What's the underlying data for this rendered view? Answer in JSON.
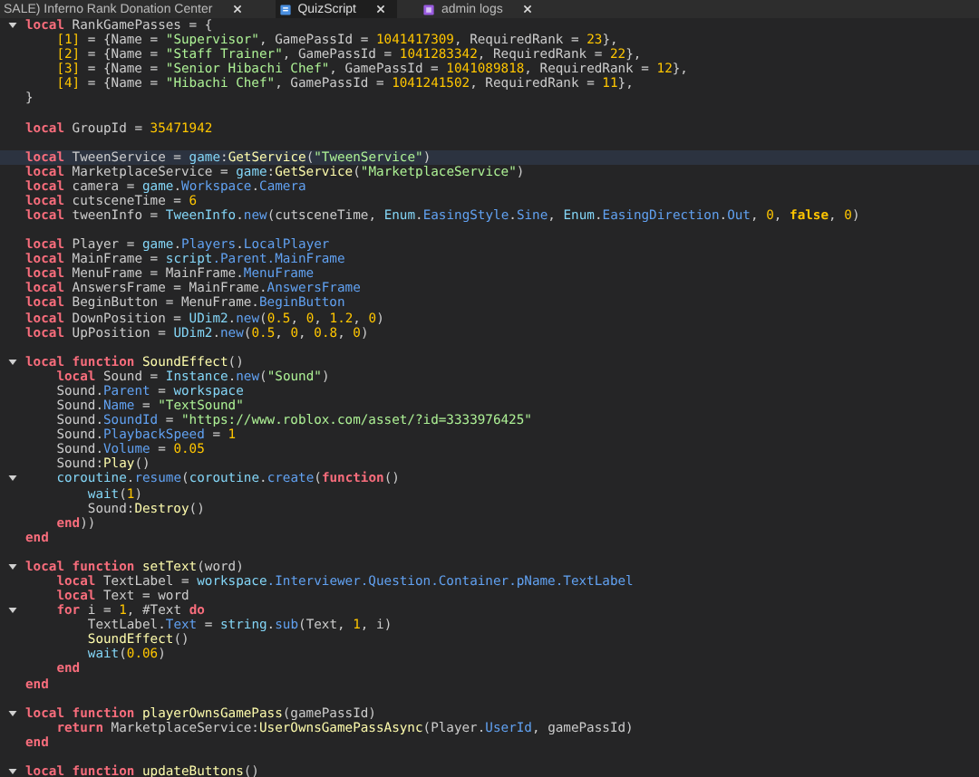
{
  "tabs": [
    {
      "label": "SALE) Inferno Rank Donation Center",
      "selected": false,
      "kind": "none"
    },
    {
      "label": "QuizScript",
      "selected": true,
      "kind": "script"
    },
    {
      "label": "admin logs",
      "selected": false,
      "kind": "module"
    }
  ],
  "lines": [
    {
      "fold": true,
      "current": false,
      "tokens": [
        {
          "kind": "kw",
          "text": "local"
        },
        {
          "kind": "p",
          "text": " RankGamePasses = {"
        }
      ]
    },
    {
      "fold": false,
      "current": false,
      "tokens": [
        {
          "kind": "num",
          "text": "    [1]"
        },
        {
          "kind": "p",
          "text": " = {Name = "
        },
        {
          "kind": "str",
          "text": "\"Supervisor\""
        },
        {
          "kind": "p",
          "text": ", GamePassId = "
        },
        {
          "kind": "num",
          "text": "1041417309"
        },
        {
          "kind": "p",
          "text": ", RequiredRank = "
        },
        {
          "kind": "num",
          "text": "23"
        },
        {
          "kind": "p",
          "text": "},"
        }
      ]
    },
    {
      "fold": false,
      "current": false,
      "tokens": [
        {
          "kind": "num",
          "text": "    [2]"
        },
        {
          "kind": "p",
          "text": " = {Name = "
        },
        {
          "kind": "str",
          "text": "\"Staff Trainer\""
        },
        {
          "kind": "p",
          "text": ", GamePassId = "
        },
        {
          "kind": "num",
          "text": "1041283342"
        },
        {
          "kind": "p",
          "text": ", RequiredRank = "
        },
        {
          "kind": "num",
          "text": "22"
        },
        {
          "kind": "p",
          "text": "},"
        }
      ]
    },
    {
      "fold": false,
      "current": false,
      "tokens": [
        {
          "kind": "num",
          "text": "    [3]"
        },
        {
          "kind": "p",
          "text": " = {Name = "
        },
        {
          "kind": "str",
          "text": "\"Senior Hibachi Chef\""
        },
        {
          "kind": "p",
          "text": ", GamePassId = "
        },
        {
          "kind": "num",
          "text": "1041089818"
        },
        {
          "kind": "p",
          "text": ", RequiredRank = "
        },
        {
          "kind": "num",
          "text": "12"
        },
        {
          "kind": "p",
          "text": "},"
        }
      ]
    },
    {
      "fold": false,
      "current": false,
      "tokens": [
        {
          "kind": "num",
          "text": "    [4]"
        },
        {
          "kind": "p",
          "text": " = {Name = "
        },
        {
          "kind": "str",
          "text": "\"Hibachi Chef\""
        },
        {
          "kind": "p",
          "text": ", GamePassId = "
        },
        {
          "kind": "num",
          "text": "1041241502"
        },
        {
          "kind": "p",
          "text": ", RequiredRank = "
        },
        {
          "kind": "num",
          "text": "11"
        },
        {
          "kind": "p",
          "text": "},"
        }
      ]
    },
    {
      "fold": false,
      "current": false,
      "tokens": [
        {
          "kind": "p",
          "text": "}"
        }
      ]
    },
    {
      "fold": false,
      "current": false
    },
    {
      "fold": false,
      "current": false,
      "tokens": [
        {
          "kind": "kw",
          "text": "local"
        },
        {
          "kind": "p",
          "text": " GroupId = "
        },
        {
          "kind": "num",
          "text": "35471942"
        }
      ]
    },
    {
      "fold": false,
      "current": false
    },
    {
      "fold": false,
      "current": true,
      "tokens": [
        {
          "kind": "kw",
          "text": "local"
        },
        {
          "kind": "p",
          "text": " TweenService = "
        },
        {
          "kind": "glob",
          "text": "game"
        },
        {
          "kind": "p",
          "text": ":"
        },
        {
          "kind": "fn",
          "text": "GetService"
        },
        {
          "kind": "p",
          "text": "("
        },
        {
          "kind": "str",
          "text": "\"TweenService\""
        },
        {
          "kind": "p",
          "text": ")"
        }
      ]
    },
    {
      "fold": false,
      "current": false,
      "tokens": [
        {
          "kind": "kw",
          "text": "local"
        },
        {
          "kind": "p",
          "text": " MarketplaceService = "
        },
        {
          "kind": "glob",
          "text": "game"
        },
        {
          "kind": "p",
          "text": ":"
        },
        {
          "kind": "fn",
          "text": "GetService"
        },
        {
          "kind": "p",
          "text": "("
        },
        {
          "kind": "str",
          "text": "\"MarketplaceService\""
        },
        {
          "kind": "p",
          "text": ")"
        }
      ]
    },
    {
      "fold": false,
      "current": false,
      "tokens": [
        {
          "kind": "kw",
          "text": "local"
        },
        {
          "kind": "p",
          "text": " camera = "
        },
        {
          "kind": "glob",
          "text": "game"
        },
        {
          "kind": "p",
          "text": "."
        },
        {
          "kind": "prop",
          "text": "Workspace"
        },
        {
          "kind": "p",
          "text": "."
        },
        {
          "kind": "prop",
          "text": "Camera"
        }
      ]
    },
    {
      "fold": false,
      "current": false,
      "tokens": [
        {
          "kind": "kw",
          "text": "local"
        },
        {
          "kind": "p",
          "text": " cutsceneTime = "
        },
        {
          "kind": "num",
          "text": "6"
        }
      ]
    },
    {
      "fold": false,
      "current": false,
      "tokens": [
        {
          "kind": "kw",
          "text": "local"
        },
        {
          "kind": "p",
          "text": " tweenInfo = "
        },
        {
          "kind": "glob",
          "text": "TweenInfo"
        },
        {
          "kind": "p",
          "text": "."
        },
        {
          "kind": "prop",
          "text": "new"
        },
        {
          "kind": "p",
          "text": "(cutsceneTime, "
        },
        {
          "kind": "glob",
          "text": "Enum"
        },
        {
          "kind": "p",
          "text": "."
        },
        {
          "kind": "prop",
          "text": "EasingStyle"
        },
        {
          "kind": "p",
          "text": "."
        },
        {
          "kind": "prop",
          "text": "Sine"
        },
        {
          "kind": "p",
          "text": ", "
        },
        {
          "kind": "glob",
          "text": "Enum"
        },
        {
          "kind": "p",
          "text": "."
        },
        {
          "kind": "prop",
          "text": "EasingDirection"
        },
        {
          "kind": "p",
          "text": "."
        },
        {
          "kind": "prop",
          "text": "Out"
        },
        {
          "kind": "p",
          "text": ", "
        },
        {
          "kind": "num",
          "text": "0"
        },
        {
          "kind": "p",
          "text": ", "
        },
        {
          "kind": "bool",
          "text": "false"
        },
        {
          "kind": "p",
          "text": ", "
        },
        {
          "kind": "num",
          "text": "0"
        },
        {
          "kind": "p",
          "text": ")"
        }
      ]
    },
    {
      "fold": false,
      "current": false
    },
    {
      "fold": false,
      "current": false,
      "tokens": [
        {
          "kind": "kw",
          "text": "local"
        },
        {
          "kind": "p",
          "text": " Player = "
        },
        {
          "kind": "glob",
          "text": "game"
        },
        {
          "kind": "p",
          "text": "."
        },
        {
          "kind": "prop",
          "text": "Players"
        },
        {
          "kind": "p",
          "text": "."
        },
        {
          "kind": "prop",
          "text": "LocalPlayer"
        }
      ]
    },
    {
      "fold": false,
      "current": false,
      "tokens": [
        {
          "kind": "kw",
          "text": "local"
        },
        {
          "kind": "p",
          "text": " MainFrame = "
        },
        {
          "kind": "glob",
          "text": "script"
        },
        {
          "kind": "prop",
          "text": ".Parent.MainFrame"
        }
      ]
    },
    {
      "fold": false,
      "current": false,
      "tokens": [
        {
          "kind": "kw",
          "text": "local"
        },
        {
          "kind": "p",
          "text": " MenuFrame = MainFrame."
        },
        {
          "kind": "prop",
          "text": "MenuFrame"
        }
      ]
    },
    {
      "fold": false,
      "current": false,
      "tokens": [
        {
          "kind": "kw",
          "text": "local"
        },
        {
          "kind": "p",
          "text": " AnswersFrame = MainFrame."
        },
        {
          "kind": "prop",
          "text": "AnswersFrame"
        }
      ]
    },
    {
      "fold": false,
      "current": false,
      "tokens": [
        {
          "kind": "kw",
          "text": "local"
        },
        {
          "kind": "p",
          "text": " BeginButton = MenuFrame."
        },
        {
          "kind": "prop",
          "text": "BeginButton"
        }
      ]
    },
    {
      "fold": false,
      "current": false,
      "tokens": [
        {
          "kind": "kw",
          "text": "local"
        },
        {
          "kind": "p",
          "text": " DownPosition = "
        },
        {
          "kind": "glob",
          "text": "UDim2"
        },
        {
          "kind": "p",
          "text": "."
        },
        {
          "kind": "prop",
          "text": "new"
        },
        {
          "kind": "p",
          "text": "("
        },
        {
          "kind": "num",
          "text": "0.5"
        },
        {
          "kind": "p",
          "text": ", "
        },
        {
          "kind": "num",
          "text": "0"
        },
        {
          "kind": "p",
          "text": ", "
        },
        {
          "kind": "num",
          "text": "1.2"
        },
        {
          "kind": "p",
          "text": ", "
        },
        {
          "kind": "num",
          "text": "0"
        },
        {
          "kind": "p",
          "text": ")"
        }
      ]
    },
    {
      "fold": false,
      "current": false,
      "tokens": [
        {
          "kind": "kw",
          "text": "local"
        },
        {
          "kind": "p",
          "text": " UpPosition = "
        },
        {
          "kind": "glob",
          "text": "UDim2"
        },
        {
          "kind": "p",
          "text": "."
        },
        {
          "kind": "prop",
          "text": "new"
        },
        {
          "kind": "p",
          "text": "("
        },
        {
          "kind": "num",
          "text": "0.5"
        },
        {
          "kind": "p",
          "text": ", "
        },
        {
          "kind": "num",
          "text": "0"
        },
        {
          "kind": "p",
          "text": ", "
        },
        {
          "kind": "num",
          "text": "0.8"
        },
        {
          "kind": "p",
          "text": ", "
        },
        {
          "kind": "num",
          "text": "0"
        },
        {
          "kind": "p",
          "text": ")"
        }
      ]
    },
    {
      "fold": false,
      "current": false
    },
    {
      "fold": true,
      "current": false,
      "tokens": [
        {
          "kind": "kw",
          "text": "local function"
        },
        {
          "kind": "fn",
          "text": " SoundEffect"
        },
        {
          "kind": "p",
          "text": "()"
        }
      ]
    },
    {
      "fold": false,
      "current": false,
      "tokens": [
        {
          "kind": "kw",
          "text": "    local"
        },
        {
          "kind": "p",
          "text": " Sound = "
        },
        {
          "kind": "glob",
          "text": "Instance"
        },
        {
          "kind": "p",
          "text": "."
        },
        {
          "kind": "prop",
          "text": "new"
        },
        {
          "kind": "p",
          "text": "("
        },
        {
          "kind": "str",
          "text": "\"Sound\""
        },
        {
          "kind": "p",
          "text": ")"
        }
      ]
    },
    {
      "fold": false,
      "current": false,
      "tokens": [
        {
          "kind": "p",
          "text": "    Sound."
        },
        {
          "kind": "prop",
          "text": "Parent"
        },
        {
          "kind": "p",
          "text": " = "
        },
        {
          "kind": "glob",
          "text": "workspace"
        }
      ]
    },
    {
      "fold": false,
      "current": false,
      "tokens": [
        {
          "kind": "p",
          "text": "    Sound."
        },
        {
          "kind": "prop",
          "text": "Name"
        },
        {
          "kind": "p",
          "text": " = "
        },
        {
          "kind": "str",
          "text": "\"TextSound\""
        }
      ]
    },
    {
      "fold": false,
      "current": false,
      "tokens": [
        {
          "kind": "p",
          "text": "    Sound."
        },
        {
          "kind": "prop",
          "text": "SoundId"
        },
        {
          "kind": "p",
          "text": " = "
        },
        {
          "kind": "str",
          "text": "\"https://www.roblox.com/asset/?id=3333976425\""
        }
      ]
    },
    {
      "fold": false,
      "current": false,
      "tokens": [
        {
          "kind": "p",
          "text": "    Sound."
        },
        {
          "kind": "prop",
          "text": "PlaybackSpeed"
        },
        {
          "kind": "p",
          "text": " = "
        },
        {
          "kind": "num",
          "text": "1"
        }
      ]
    },
    {
      "fold": false,
      "current": false,
      "tokens": [
        {
          "kind": "p",
          "text": "    Sound."
        },
        {
          "kind": "prop",
          "text": "Volume"
        },
        {
          "kind": "p",
          "text": " = "
        },
        {
          "kind": "num",
          "text": "0.05"
        }
      ]
    },
    {
      "fold": false,
      "current": false,
      "tokens": [
        {
          "kind": "p",
          "text": "    Sound:"
        },
        {
          "kind": "fn",
          "text": "Play"
        },
        {
          "kind": "p",
          "text": "()"
        }
      ]
    },
    {
      "fold": true,
      "current": false,
      "tokens": [
        {
          "kind": "glob",
          "text": "    coroutine"
        },
        {
          "kind": "p",
          "text": "."
        },
        {
          "kind": "prop",
          "text": "resume"
        },
        {
          "kind": "p",
          "text": "("
        },
        {
          "kind": "glob",
          "text": "coroutine"
        },
        {
          "kind": "p",
          "text": "."
        },
        {
          "kind": "prop",
          "text": "create"
        },
        {
          "kind": "p",
          "text": "("
        },
        {
          "kind": "kw",
          "text": "function"
        },
        {
          "kind": "p",
          "text": "()"
        }
      ]
    },
    {
      "fold": false,
      "current": false,
      "tokens": [
        {
          "kind": "glob",
          "text": "        wait"
        },
        {
          "kind": "p",
          "text": "("
        },
        {
          "kind": "num",
          "text": "1"
        },
        {
          "kind": "p",
          "text": ")"
        }
      ]
    },
    {
      "fold": false,
      "current": false,
      "tokens": [
        {
          "kind": "p",
          "text": "        Sound:"
        },
        {
          "kind": "fn",
          "text": "Destroy"
        },
        {
          "kind": "p",
          "text": "()"
        }
      ]
    },
    {
      "fold": false,
      "current": false,
      "tokens": [
        {
          "kind": "kw",
          "text": "    end"
        },
        {
          "kind": "p",
          "text": "))"
        }
      ]
    },
    {
      "fold": false,
      "current": false,
      "tokens": [
        {
          "kind": "kw",
          "text": "end"
        }
      ]
    },
    {
      "fold": false,
      "current": false
    },
    {
      "fold": true,
      "current": false,
      "tokens": [
        {
          "kind": "kw",
          "text": "local function"
        },
        {
          "kind": "fn",
          "text": " setText"
        },
        {
          "kind": "p",
          "text": "(word)"
        }
      ]
    },
    {
      "fold": false,
      "current": false,
      "tokens": [
        {
          "kind": "kw",
          "text": "    local"
        },
        {
          "kind": "p",
          "text": " TextLabel = "
        },
        {
          "kind": "glob",
          "text": "workspace"
        },
        {
          "kind": "prop",
          "text": ".Interviewer.Question.Container.pName.TextLabel"
        }
      ]
    },
    {
      "fold": false,
      "current": false,
      "tokens": [
        {
          "kind": "kw",
          "text": "    local"
        },
        {
          "kind": "p",
          "text": " Text = word"
        }
      ]
    },
    {
      "fold": true,
      "current": false,
      "tokens": [
        {
          "kind": "kw",
          "text": "    for"
        },
        {
          "kind": "p",
          "text": " i = "
        },
        {
          "kind": "num",
          "text": "1"
        },
        {
          "kind": "p",
          "text": ", #Text "
        },
        {
          "kind": "kw",
          "text": "do"
        }
      ]
    },
    {
      "fold": false,
      "current": false,
      "tokens": [
        {
          "kind": "p",
          "text": "        TextLabel."
        },
        {
          "kind": "prop",
          "text": "Text"
        },
        {
          "kind": "p",
          "text": " = "
        },
        {
          "kind": "glob",
          "text": "string"
        },
        {
          "kind": "p",
          "text": "."
        },
        {
          "kind": "prop",
          "text": "sub"
        },
        {
          "kind": "p",
          "text": "(Text, "
        },
        {
          "kind": "num",
          "text": "1"
        },
        {
          "kind": "p",
          "text": ", i)"
        }
      ]
    },
    {
      "fold": false,
      "current": false,
      "tokens": [
        {
          "kind": "fn",
          "text": "        SoundEffect"
        },
        {
          "kind": "p",
          "text": "()"
        }
      ]
    },
    {
      "fold": false,
      "current": false,
      "tokens": [
        {
          "kind": "glob",
          "text": "        wait"
        },
        {
          "kind": "p",
          "text": "("
        },
        {
          "kind": "num",
          "text": "0.06"
        },
        {
          "kind": "p",
          "text": ")"
        }
      ]
    },
    {
      "fold": false,
      "current": false,
      "tokens": [
        {
          "kind": "kw",
          "text": "    end"
        }
      ]
    },
    {
      "fold": false,
      "current": false,
      "tokens": [
        {
          "kind": "kw",
          "text": "end"
        }
      ]
    },
    {
      "fold": false,
      "current": false
    },
    {
      "fold": true,
      "current": false,
      "tokens": [
        {
          "kind": "kw",
          "text": "local function"
        },
        {
          "kind": "fn",
          "text": " playerOwnsGamePass"
        },
        {
          "kind": "p",
          "text": "(gamePassId)"
        }
      ]
    },
    {
      "fold": false,
      "current": false,
      "tokens": [
        {
          "kind": "kw",
          "text": "    return"
        },
        {
          "kind": "p",
          "text": " MarketplaceService:"
        },
        {
          "kind": "fn",
          "text": "UserOwnsGamePassAsync"
        },
        {
          "kind": "p",
          "text": "(Player."
        },
        {
          "kind": "prop",
          "text": "UserId"
        },
        {
          "kind": "p",
          "text": ", gamePassId)"
        }
      ]
    },
    {
      "fold": false,
      "current": false,
      "tokens": [
        {
          "kind": "kw",
          "text": "end"
        }
      ]
    },
    {
      "fold": false,
      "current": false
    },
    {
      "fold": true,
      "current": false,
      "tokens": [
        {
          "kind": "kw",
          "text": "local function"
        },
        {
          "kind": "fn",
          "text": " updateButtons"
        },
        {
          "kind": "p",
          "text": "()"
        }
      ]
    }
  ]
}
